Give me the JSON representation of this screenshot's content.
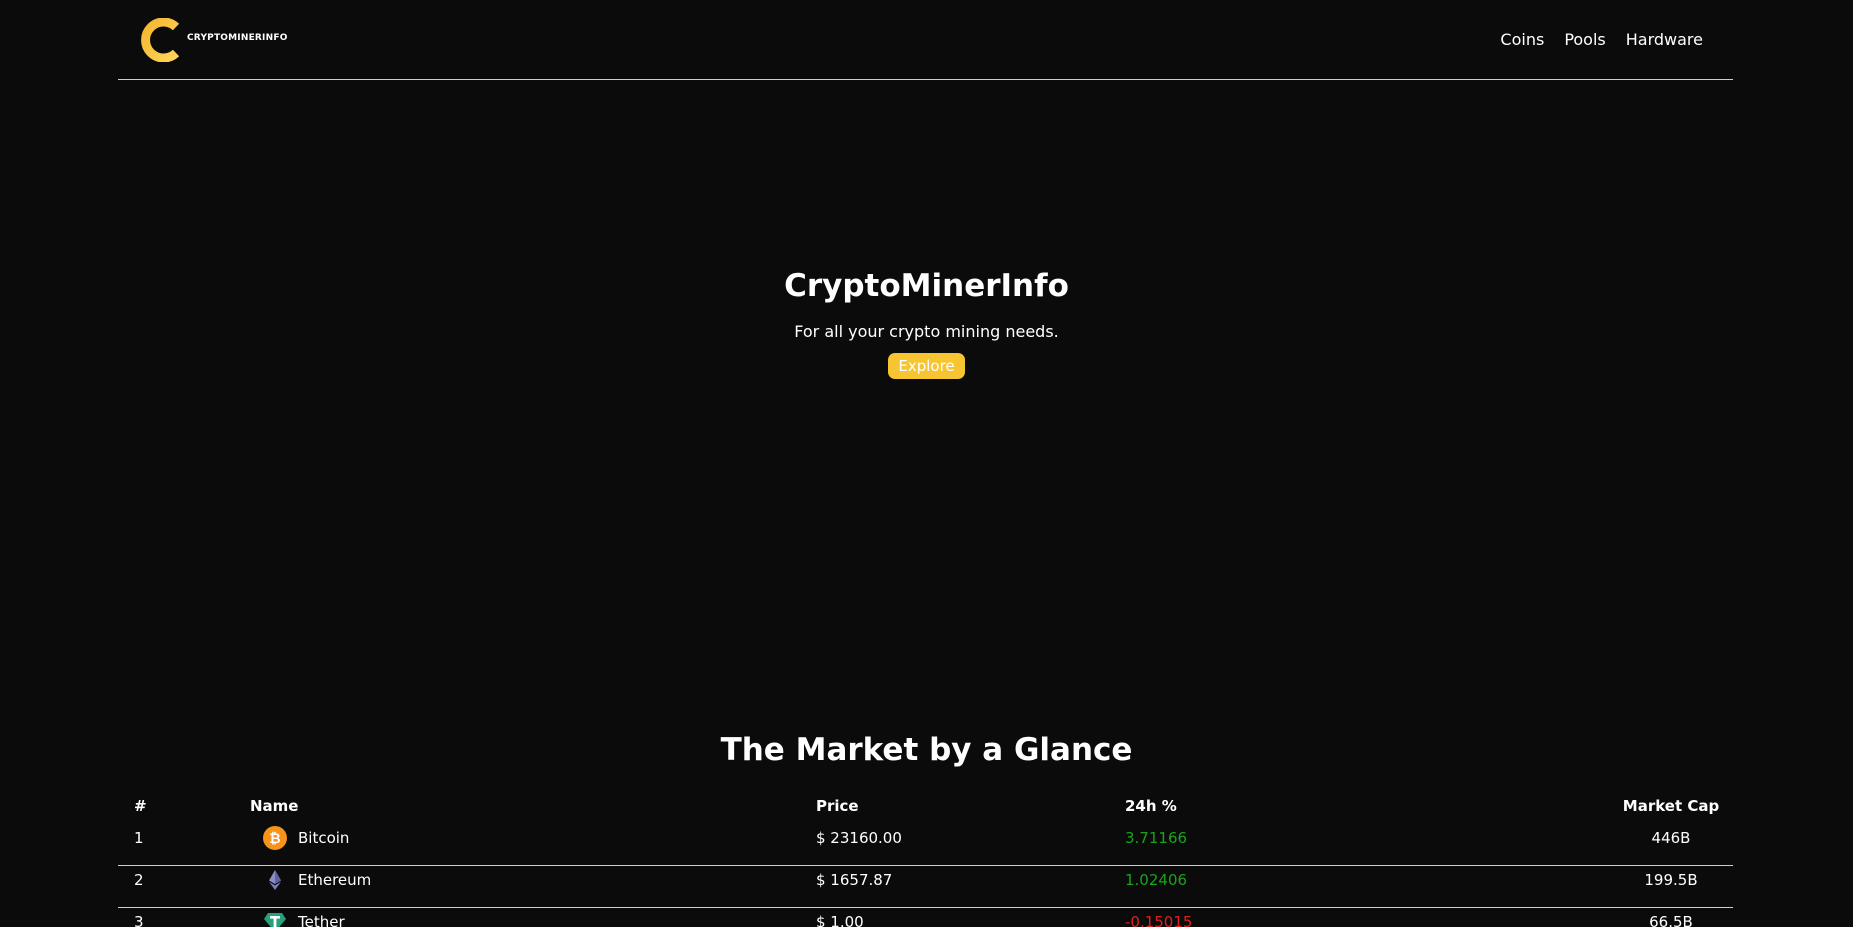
{
  "header": {
    "logo_text": "CRYPTOMINERINFO",
    "nav": [
      {
        "label": "Coins"
      },
      {
        "label": "Pools"
      },
      {
        "label": "Hardware"
      }
    ]
  },
  "hero": {
    "title": "CryptoMinerInfo",
    "subtitle": "For all your crypto mining needs.",
    "button_label": "Explore"
  },
  "market": {
    "title": "The Market by a Glance",
    "columns": [
      "#",
      "Name",
      "Price",
      "24h %",
      "Market Cap"
    ],
    "rows": [
      {
        "rank": "1",
        "name": "Bitcoin",
        "icon": "bitcoin-icon",
        "price": "$ 23160.00",
        "change": "3.71166",
        "trend": "up",
        "cap": "446B"
      },
      {
        "rank": "2",
        "name": "Ethereum",
        "icon": "ethereum-icon",
        "price": "$ 1657.87",
        "change": "1.02406",
        "trend": "up",
        "cap": "199.5B"
      },
      {
        "rank": "3",
        "name": "Tether",
        "icon": "tether-icon",
        "price": "$ 1.00",
        "change": "-0.15015",
        "trend": "down",
        "cap": "66.5B"
      }
    ]
  },
  "colors": {
    "background": "#0b0b0b",
    "accent": "#f7c531",
    "positive": "#1aa31a",
    "negative": "#e11f1f",
    "bitcoin": "#f7931a",
    "ethereum": "#7a7fb8",
    "tether": "#26a17b"
  }
}
